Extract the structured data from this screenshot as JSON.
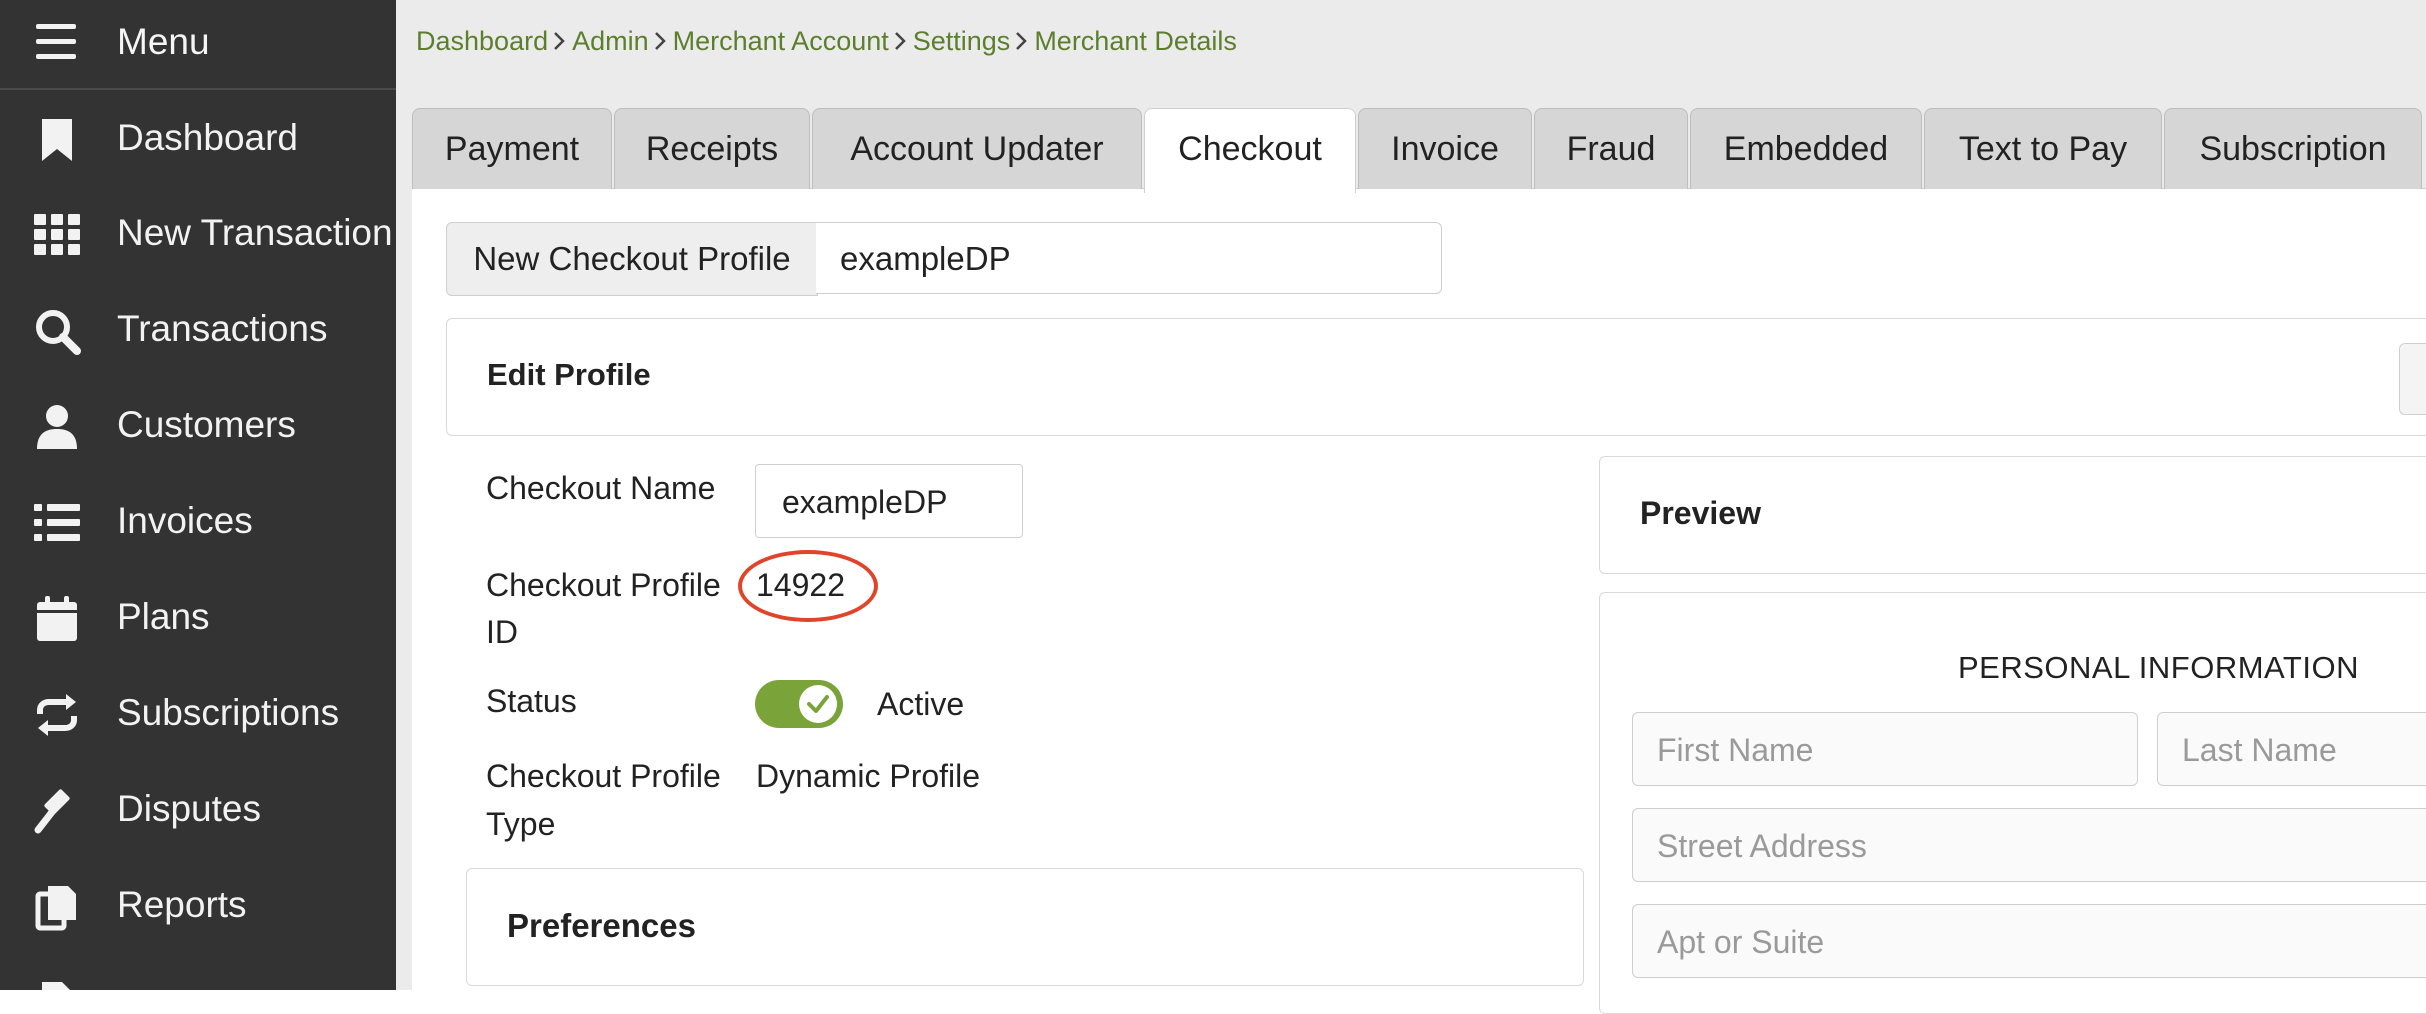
{
  "sidebar": {
    "menu_label": "Menu",
    "items": [
      {
        "label": "Dashboard",
        "icon": "bookmark-icon"
      },
      {
        "label": "New Transaction",
        "icon": "grid-icon"
      },
      {
        "label": "Transactions",
        "icon": "search-icon"
      },
      {
        "label": "Customers",
        "icon": "user-icon"
      },
      {
        "label": "Invoices",
        "icon": "list-icon"
      },
      {
        "label": "Plans",
        "icon": "calendar-icon"
      },
      {
        "label": "Subscriptions",
        "icon": "repeat-icon"
      },
      {
        "label": "Disputes",
        "icon": "gavel-icon"
      },
      {
        "label": "Reports",
        "icon": "copy-icon"
      }
    ]
  },
  "breadcrumb": [
    "Dashboard",
    "Admin",
    "Merchant Account",
    "Settings",
    "Merchant Details"
  ],
  "tabs": [
    {
      "label": "Payment"
    },
    {
      "label": "Receipts"
    },
    {
      "label": "Account Updater"
    },
    {
      "label": "Checkout",
      "active": true
    },
    {
      "label": "Invoice"
    },
    {
      "label": "Fraud"
    },
    {
      "label": "Embedded"
    },
    {
      "label": "Text to Pay"
    },
    {
      "label": "Subscription"
    }
  ],
  "profile_selector": {
    "button_label": "New Checkout Profile",
    "selected": "exampleDP"
  },
  "edit_profile": {
    "title": "Edit Profile",
    "checkout_name_label": "Checkout Name",
    "checkout_name_value": "exampleDP",
    "profile_id_label_line1": "Checkout Profile",
    "profile_id_label_line2": "ID",
    "profile_id_value": "14922",
    "status_label": "Status",
    "status_value": "Active",
    "status_on": true,
    "type_label_line1": "Checkout Profile",
    "type_label_line2": "Type",
    "type_value": "Dynamic Profile"
  },
  "preferences": {
    "title": "Preferences"
  },
  "preview": {
    "title": "Preview",
    "section_title": "PERSONAL INFORMATION",
    "first_name_placeholder": "First Name",
    "last_name_placeholder": "Last Name",
    "street_placeholder": "Street Address",
    "apt_placeholder": "Apt or Suite"
  },
  "colors": {
    "sidebar_bg": "#333333",
    "breadcrumb_link": "#5c7f2e",
    "toggle_on": "#7aa33a",
    "highlight_circle": "#e0452b"
  }
}
